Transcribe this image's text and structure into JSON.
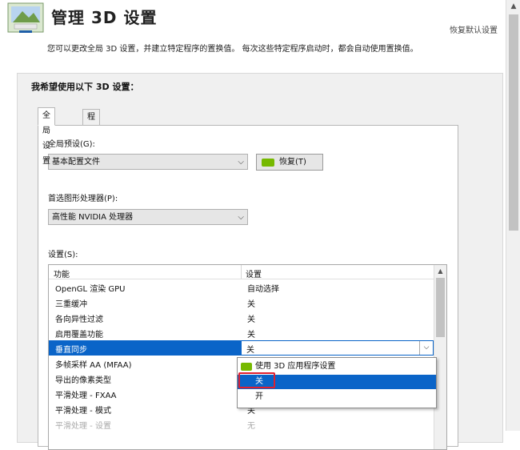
{
  "header": {
    "title": "管理 3D 设置",
    "restore_defaults": "恢复默认设置",
    "description": "您可以更改全局 3D 设置，并建立特定程序的置换值。 每次这些特定程序启动时，都会自动使用置换值。"
  },
  "panel": {
    "title": "我希望使用以下 3D 设置：",
    "tabs": [
      {
        "label": "全局设置",
        "active": true
      },
      {
        "label": "程序设置",
        "active": false
      }
    ],
    "global_preset": {
      "label": "全局预设(G):",
      "value": "基本配置文件",
      "restore_button": "恢复(T)"
    },
    "preferred_gpu": {
      "label": "首选图形处理器(P):",
      "value": "高性能 NVIDIA 处理器"
    },
    "settings": {
      "label": "设置(S):",
      "columns": [
        "功能",
        "设置"
      ],
      "rows": [
        {
          "feature": "OpenGL 渲染 GPU",
          "value": "自动选择"
        },
        {
          "feature": "三重缓冲",
          "value": "关"
        },
        {
          "feature": "各向异性过滤",
          "value": "关"
        },
        {
          "feature": "启用覆盖功能",
          "value": "关"
        },
        {
          "feature": "垂直同步",
          "value": "关",
          "selected": true
        },
        {
          "feature": "多帧采样 AA (MFAA)",
          "value": ""
        },
        {
          "feature": "导出的像素类型",
          "value": ""
        },
        {
          "feature": "平滑处理 - FXAA",
          "value": ""
        },
        {
          "feature": "平滑处理 - 模式",
          "value": "关"
        },
        {
          "feature": "平滑处理 - 设置",
          "value": "无",
          "disabled": true
        }
      ]
    },
    "dropdown_options": [
      {
        "label": "使用 3D 应用程序设置",
        "icon": "nvidia-logo-icon"
      },
      {
        "label": "关",
        "highlighted": true
      },
      {
        "label": "开"
      }
    ]
  },
  "colors": {
    "selection": "#0a64c8",
    "nvidia_green": "#76b900",
    "highlight_box": "#e0202f"
  }
}
